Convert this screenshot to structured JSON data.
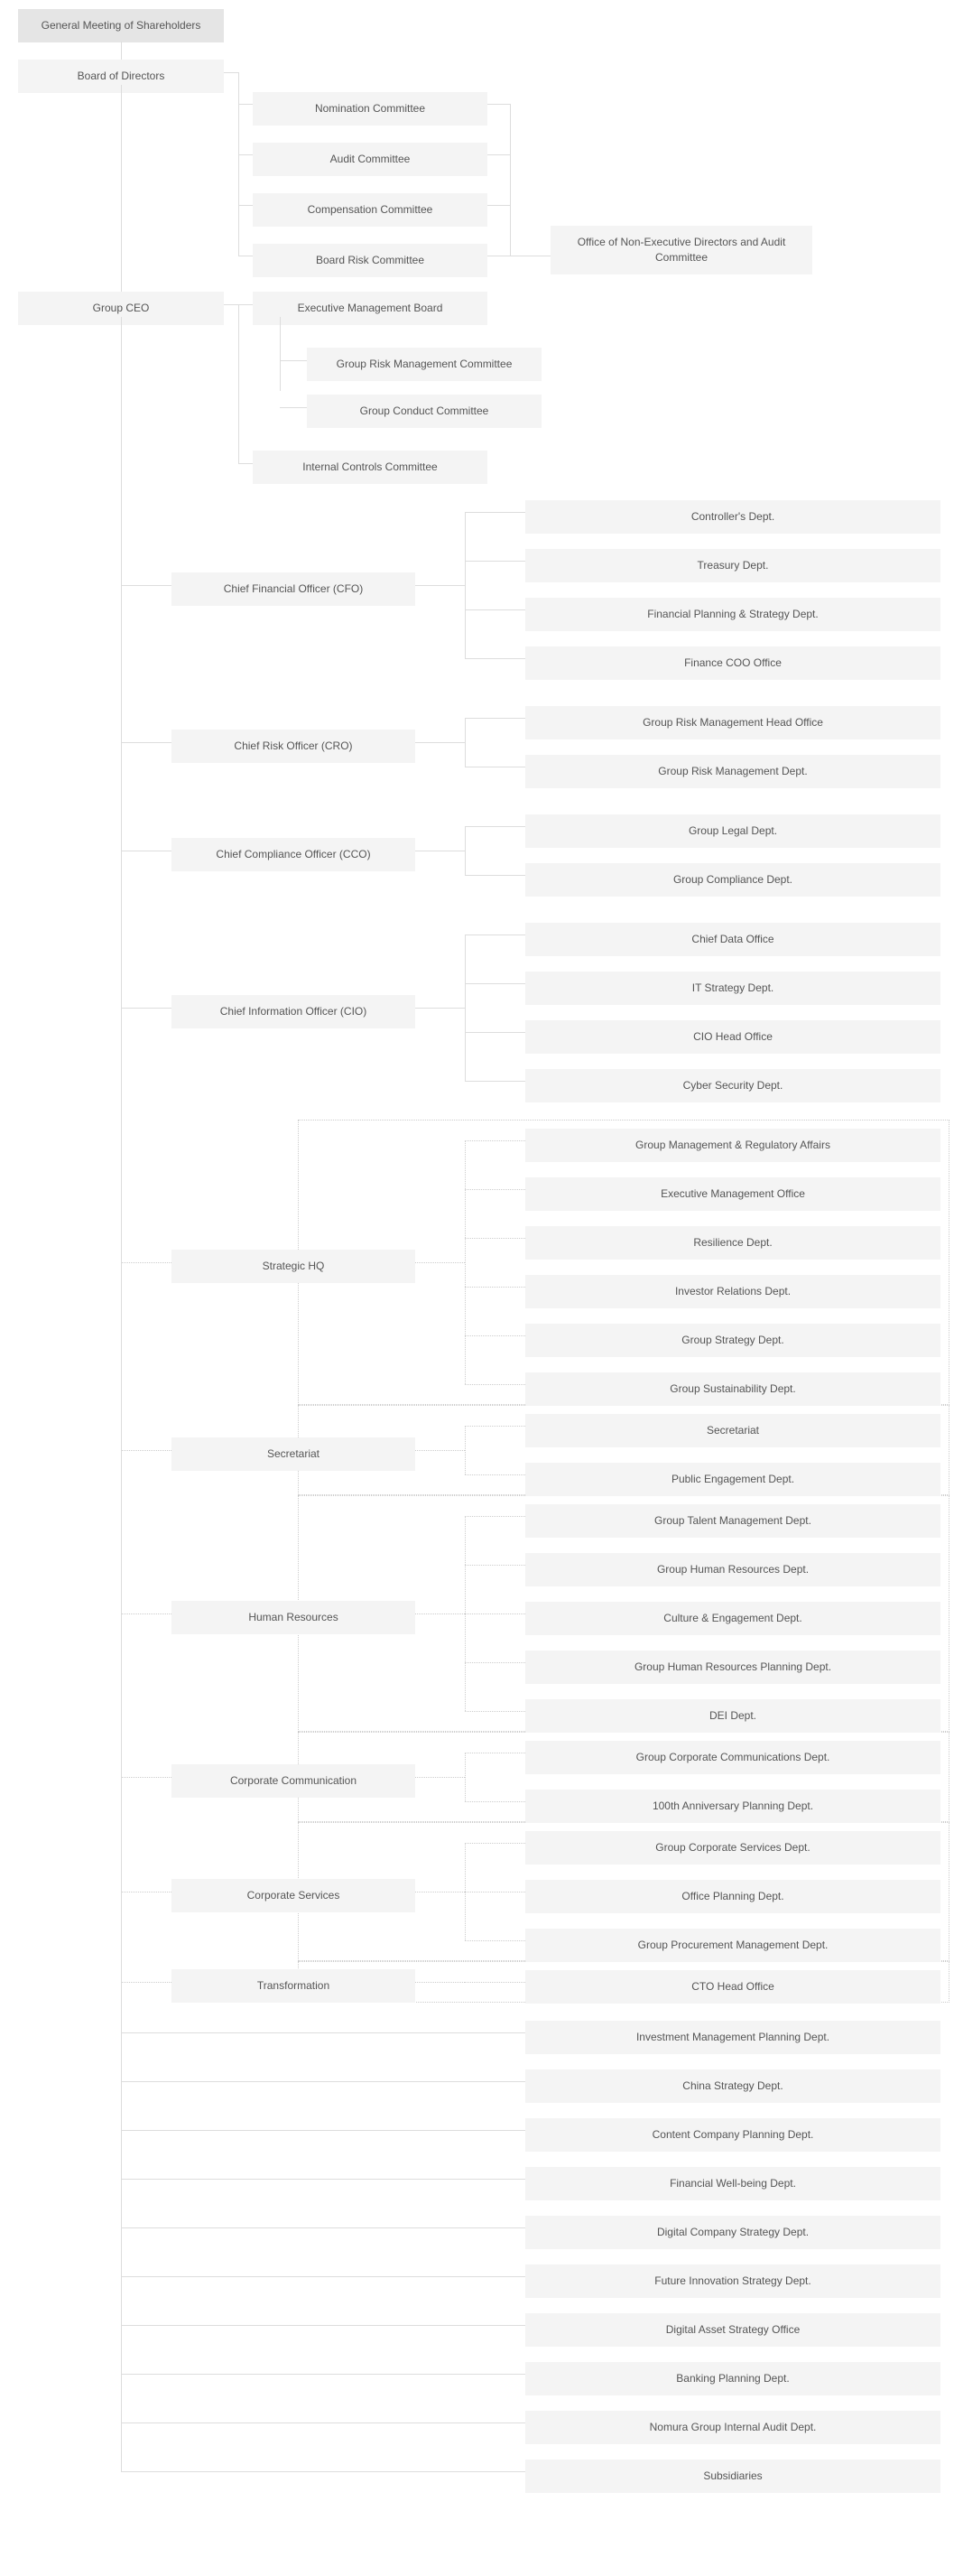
{
  "top": {
    "gm": "General Meeting of Shareholders",
    "bod": "Board of Directors",
    "nomination": "Nomination Committee",
    "audit": "Audit Committee",
    "compensation": "Compensation Committee",
    "board_risk": "Board Risk Committee",
    "office_ne": "Office of Non-Executive Directors and Audit Committee"
  },
  "ceo": {
    "ceo": "Group CEO",
    "emb": "Executive Management Board",
    "grmc": "Group Risk Management Committee",
    "gcc": "Group Conduct Committee",
    "icc": "Internal Controls Committee"
  },
  "cfo": {
    "title": "Chief  Financial Officer (CFO)",
    "items": [
      "Controller's Dept.",
      "Treasury Dept.",
      "Financial Planning & Strategy Dept.",
      "Finance COO Office"
    ]
  },
  "cro": {
    "title": "Chief  Risk Officer (CRO)",
    "items": [
      "Group Risk Management Head Office",
      "Group Risk Management Dept."
    ]
  },
  "cco": {
    "title": "Chief  Compliance Officer (CCO)",
    "items": [
      "Group Legal Dept.",
      "Group Compliance Dept."
    ]
  },
  "cio": {
    "title": "Chief  Information Officer (CIO)",
    "items": [
      "Chief Data Office",
      "IT Strategy Dept.",
      "CIO Head Office",
      "Cyber Security Dept."
    ]
  },
  "shq": {
    "title": "Strategic HQ",
    "items": [
      "Group Management & Regulatory Affairs",
      "Executive Management Office",
      "Resilience Dept.",
      "Investor Relations Dept.",
      "Group Strategy Dept.",
      "Group Sustainability Dept."
    ]
  },
  "sec": {
    "title": "Secretariat",
    "items": [
      "Secretariat",
      "Public Engagement Dept."
    ]
  },
  "hr": {
    "title": "Human Resources",
    "items": [
      "Group Talent Management Dept.",
      "Group Human Resources Dept.",
      "Culture & Engagement Dept.",
      "Group Human Resources Planning Dept.",
      "DEI Dept."
    ]
  },
  "cc": {
    "title": "Corporate Communication",
    "items": [
      "Group Corporate Communications Dept.",
      "100th Anniversary Planning Dept."
    ]
  },
  "cs": {
    "title": "Corporate Services",
    "items": [
      "Group Corporate Services Dept.",
      "Office Planning Dept.",
      "Group Procurement Management Dept."
    ]
  },
  "tr": {
    "title": "Transformation",
    "items": [
      "CTO Head Office"
    ]
  },
  "tail": [
    "Investment Management Planning Dept.",
    "China Strategy Dept.",
    "Content Company Planning Dept.",
    "Financial Well-being Dept.",
    "Digital Company Strategy Dept.",
    "Future Innovation Strategy Dept.",
    "Digital Asset Strategy Office",
    "Banking Planning Dept.",
    "Nomura Group Internal Audit Dept.",
    "Subsidiaries"
  ]
}
